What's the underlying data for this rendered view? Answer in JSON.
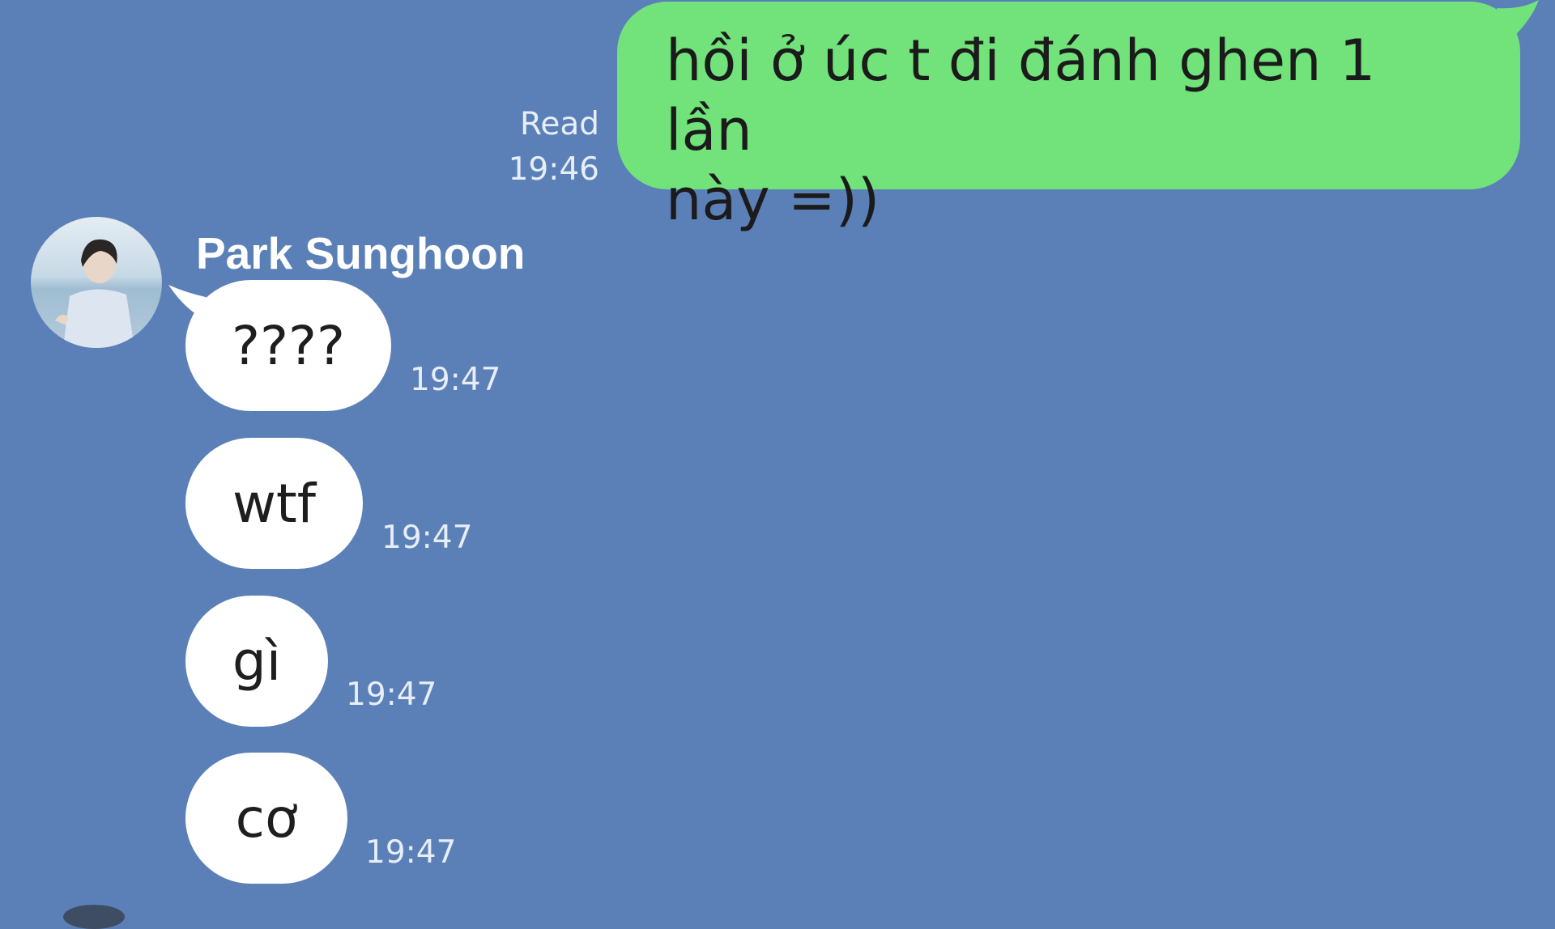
{
  "chat": {
    "outgoing": {
      "text_line1": "hồi ở úc t đi đánh ghen 1 lần",
      "text_line2": "này =))",
      "status": "Read",
      "time": "19:46"
    },
    "sender": {
      "name": "Park Sunghoon",
      "avatar_icon": "profile-photo"
    },
    "incoming": [
      {
        "text": "????",
        "time": "19:47"
      },
      {
        "text": "wtf",
        "time": "19:47"
      },
      {
        "text": "gì",
        "time": "19:47"
      },
      {
        "text": "cơ",
        "time": "19:47"
      }
    ]
  },
  "colors": {
    "background": "#5b80b8",
    "outgoing_bubble": "#71e37a",
    "incoming_bubble": "#ffffff",
    "meta_text": "#e7eef8"
  }
}
